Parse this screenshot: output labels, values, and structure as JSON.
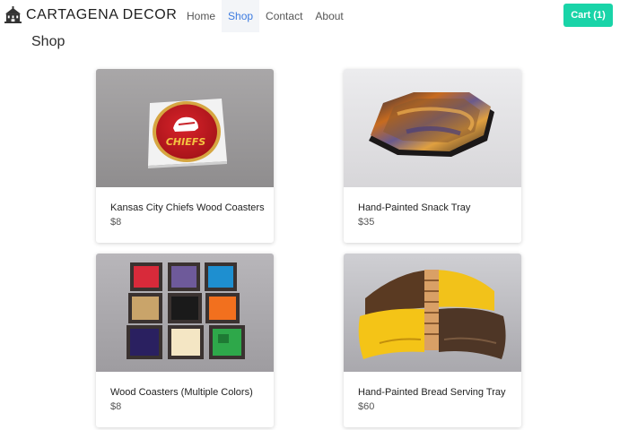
{
  "brand": {
    "name": "CARTAGENA DECOR",
    "logo_icon": "castle-icon"
  },
  "nav": {
    "items": [
      {
        "label": "Home",
        "active": false
      },
      {
        "label": "Shop",
        "active": true
      },
      {
        "label": "Contact",
        "active": false
      },
      {
        "label": "About",
        "active": false
      }
    ],
    "cart_label": "Cart (1)"
  },
  "colors": {
    "accent": "#19d4a8",
    "active_link": "#3d7be0"
  },
  "page": {
    "title": "Shop"
  },
  "products": [
    {
      "name": "Kansas City Chiefs Wood Coasters",
      "price": "$8",
      "image": "chiefs-coaster-photo"
    },
    {
      "name": "Hand-Painted Snack Tray",
      "price": "$35",
      "image": "octagonal-tray-photo"
    },
    {
      "name": "Wood Coasters (Multiple Colors)",
      "price": "$8",
      "image": "colored-coasters-photo"
    },
    {
      "name": "Hand-Painted Bread Serving Tray",
      "price": "$60",
      "image": "bread-tray-photo"
    }
  ]
}
